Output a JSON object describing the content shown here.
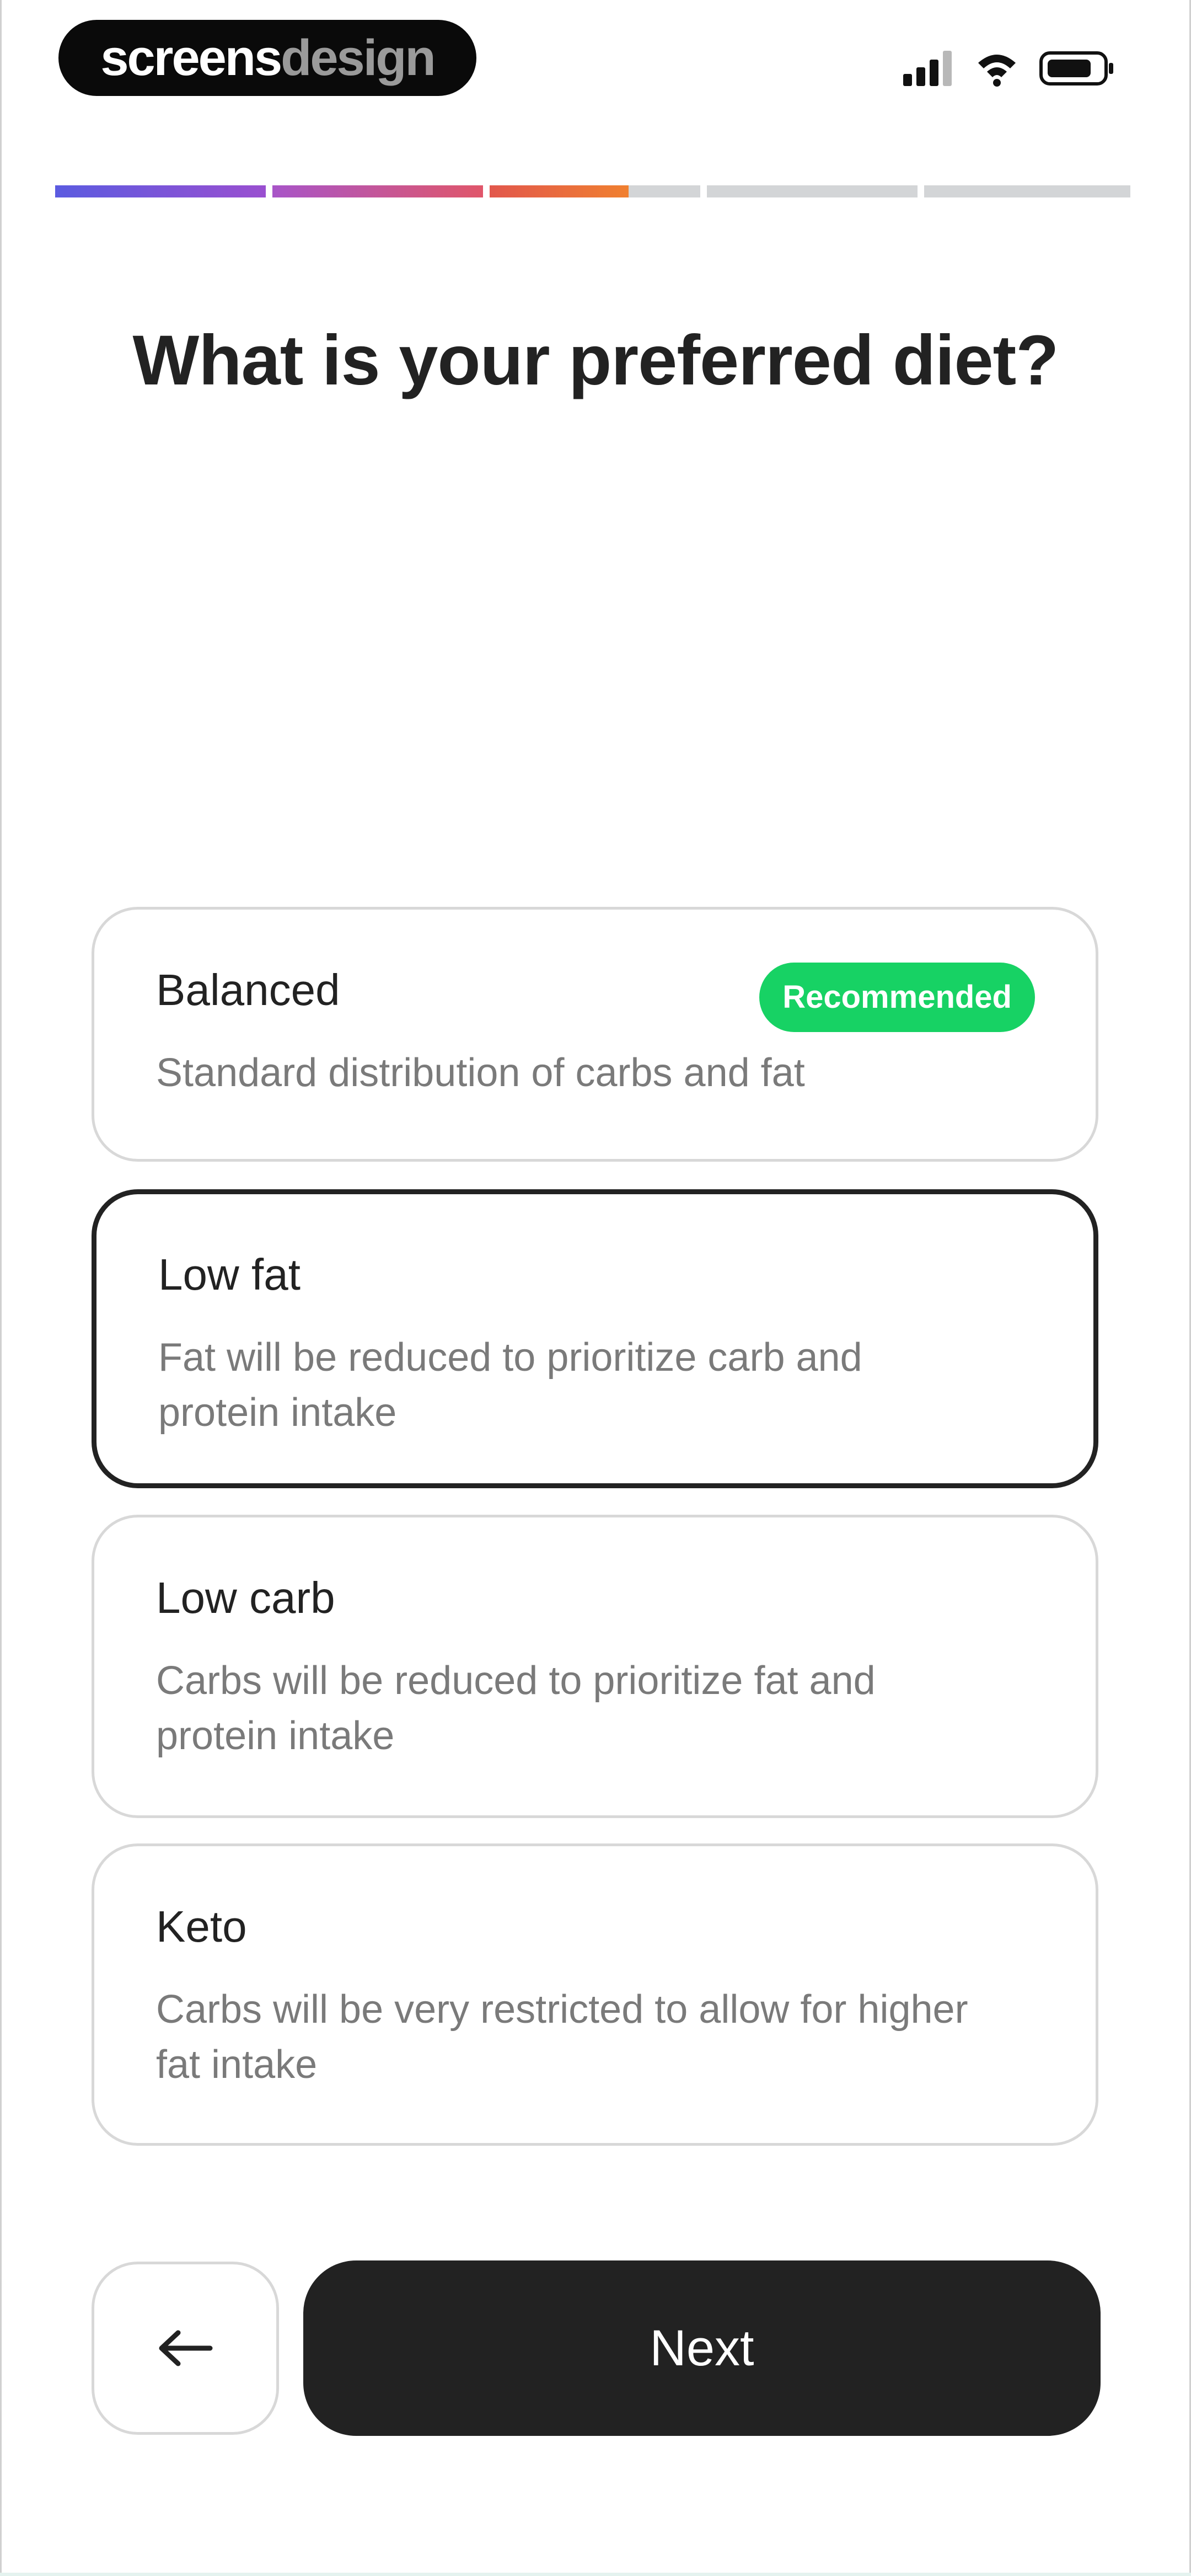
{
  "brand": {
    "part1": "screens",
    "part2": "design"
  },
  "status_icons": [
    "signal-icon",
    "wifi-icon",
    "battery-icon"
  ],
  "progress": {
    "completed_fraction": 0.53,
    "segments": [
      {
        "state": "complete",
        "color": "#5b5be0 → #9a4fd0"
      },
      {
        "state": "complete",
        "color": "#a855c8 → #e0566a"
      },
      {
        "state": "partial",
        "fraction": 0.65,
        "color": "#e2574c → #f08030"
      },
      {
        "state": "empty"
      },
      {
        "state": "empty"
      }
    ],
    "empty_color": "#d3d5d7"
  },
  "question": "What is your preferred diet?",
  "options": [
    {
      "title": "Balanced",
      "description": "Standard distribution of carbs and fat",
      "badge": "Recommended",
      "selected": false
    },
    {
      "title": "Low fat",
      "description": "Fat will be reduced to prioritize carb and protein intake",
      "selected": true
    },
    {
      "title": "Low carb",
      "description": "Carbs will be reduced to prioritize fat and protein intake",
      "selected": false
    },
    {
      "title": "Keto",
      "description": "Carbs will be very restricted to allow for higher fat intake",
      "selected": false
    }
  ],
  "buttons": {
    "back_icon": "arrow-left-icon",
    "next_label": "Next"
  },
  "colors": {
    "accent_badge": "#17d264",
    "primary_button": "#222222",
    "selected_border": "#222222"
  }
}
